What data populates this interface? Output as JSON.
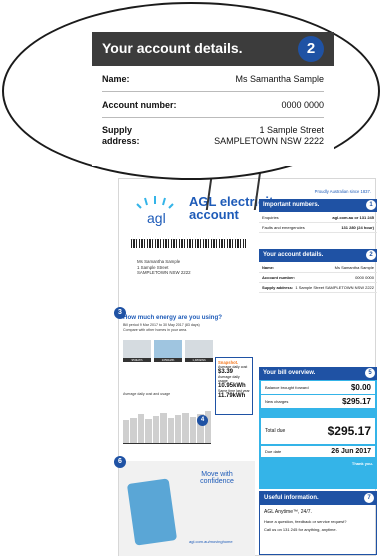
{
  "zoom": {
    "title": "Your account details.",
    "badge": "2",
    "name_label": "Name:",
    "name_value": "Ms Samantha Sample",
    "account_label": "Account number:",
    "account_value": "0000 0000",
    "supply_label_1": "Supply",
    "supply_label_2": "address:",
    "supply_value_1": "1 Sample Street",
    "supply_value_2": "SAMPLETOWN NSW 2222"
  },
  "bill": {
    "proudly": "Proudly Australian since 1837.",
    "brand_1": "AGL electricity",
    "brand_2": "account",
    "address_lines": [
      "Ms Samantha Sample",
      "1 Sample Street",
      "SAMPLETOWN NSW 2222"
    ],
    "important": {
      "badge": "1",
      "title": "Important numbers.",
      "rows": [
        {
          "label": "Enquiries",
          "value": "agl.com.au or 131 245"
        },
        {
          "label": "Faults and emergencies",
          "value": "131 280 (24 hour)"
        }
      ]
    },
    "account": {
      "badge": "2",
      "title": "Your account details.",
      "rows": [
        {
          "label": "Name:",
          "value": "Ms Samantha Sample"
        },
        {
          "label": "Account number:",
          "value": "0000 0000"
        },
        {
          "label": "Supply address:",
          "value": "1 Sample Street SAMPLETOWN NSW 2222"
        }
      ]
    },
    "energy": {
      "badge": "3",
      "title": "How much energy are you using?",
      "period": "Bill period 9 Mar 2017 to 30 May 2017 (83 days)",
      "compare": "Compare with other homes in your area.",
      "houses": [
        "950kWh",
        "1050kWh",
        "1,480kWh"
      ],
      "average": "Average daily cost and usage",
      "chart_badge": "4",
      "snapshot": {
        "title": "Snapshot.",
        "cost_label": "Average daily cost",
        "cost_value": "$3.39",
        "usage_label": "Average daily usage",
        "usage_value": "10.95kWh",
        "last_label": "Same time last year",
        "last_value": "11.79kWh"
      }
    },
    "overview": {
      "badge": "5",
      "title": "Your bill overview.",
      "balance_label": "Balance brought forward",
      "balance_value": "$0.00",
      "charges_label": "New charges",
      "charges_value": "$295.17",
      "total_label": "Total due",
      "total_value": "$295.17",
      "due_label": "Due date",
      "due_value": "26 Jun 2017",
      "thanks": "Thank you."
    },
    "move": {
      "badge": "6",
      "title_1": "Move with",
      "title_2": "confidence",
      "link": "agl.com.au/movinghome"
    },
    "useful": {
      "badge": "7",
      "title": "Useful information.",
      "line1": "AGL Anytime™, 24/7.",
      "line2": "Have a question, feedback or service request?",
      "line3": "Call us on 131 245 for anything, anytime."
    }
  },
  "colors": {
    "brand_blue": "#1f52a4",
    "sky_blue": "#34b4e8",
    "dark_header": "#3c3c3c",
    "orange": "#f47920"
  }
}
